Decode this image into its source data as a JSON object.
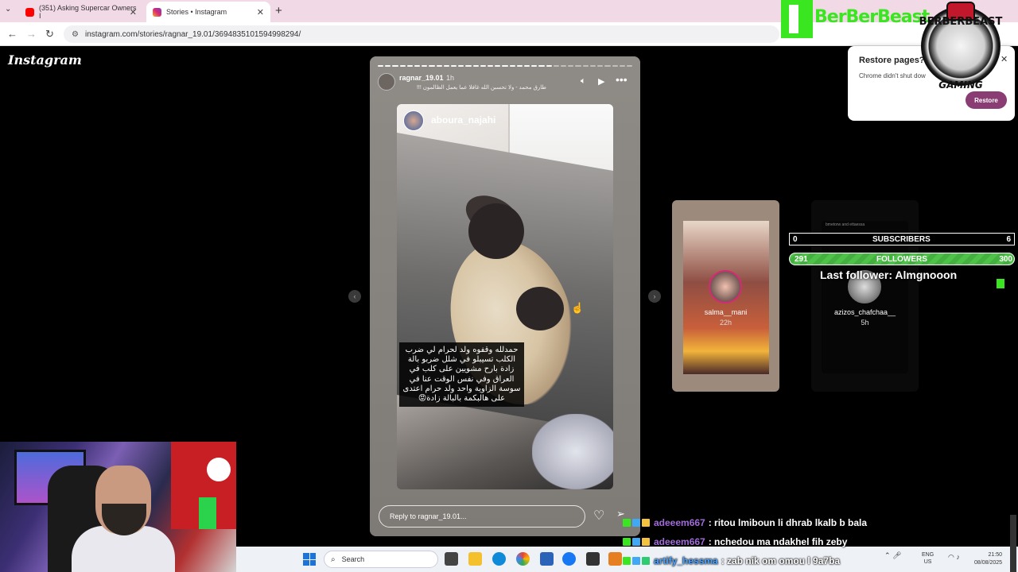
{
  "browser": {
    "tabs": [
      {
        "label": "(351) Asking Supercar Owners I",
        "favicon_color": "#ff0000",
        "active": false
      },
      {
        "label": "Stories • Instagram",
        "favicon_color": "#d62976",
        "active": true
      }
    ],
    "new_tab_icon": "plus-icon",
    "url": "instagram.com/stories/ragnar_19.01/3694835101594998294/"
  },
  "instagram": {
    "logo": "Instagram",
    "story": {
      "username": "ragnar_19.01",
      "time": "1h",
      "music": "طارق محمد - ولا تحسبن الله غافلا عما يعمل الظالمون !!!",
      "inner_username": "aboura_najahi",
      "caption": "حمدلله وقفوه ولد لحرام لي ضرب الكلب تسيبلو في شلل ضربو بالة زادة بارح مشويين على كلب في العراق وفي نفس الوقت عنا في سوسة الزاوية واحد ولد حرام اعتدى على هالبكمة بالبالة زادة😡",
      "reply_placeholder": "Reply to ragnar_19.01...",
      "progress_segments_total": 35,
      "progress_segments_done": 24
    },
    "side_stories": [
      {
        "username": "salma__mani",
        "time": "22h"
      },
      {
        "username": "azizos_chafchaa__",
        "time": "5h",
        "caption": "bmetorw and ettaessa"
      }
    ]
  },
  "restore_popup": {
    "title": "Restore pages?",
    "description": "Chrome didn't shut dow",
    "button": "Restore"
  },
  "overlay": {
    "brand_text": "BerBerBeast",
    "badge_top": "BERBERBEAST",
    "badge_bottom": "GAMING",
    "subscribers": {
      "current": "0",
      "label": "SUBSCRIBERS",
      "target": "6"
    },
    "followers": {
      "current": "291",
      "label": "FOLLOWERS",
      "target": "300",
      "fill_fraction": 0.97
    },
    "last_follower": "Last follower: Almgnooon",
    "accent_color": "#39e61f"
  },
  "taskbar": {
    "search_placeholder": "Search",
    "lang_top": "ENG",
    "lang_bottom": "US",
    "time": "21:50",
    "date": "08/08/2025"
  },
  "chat": [
    {
      "nick": "adeeem667",
      "text": ": ritou lmiboun li dhrab lkalb b bala"
    },
    {
      "nick": "adeeem667",
      "text": ": nchedou ma ndakhel fih zeby"
    },
    {
      "nick": "artify_hessma",
      "text": ": zab nik om omou l 9a7ba"
    }
  ]
}
